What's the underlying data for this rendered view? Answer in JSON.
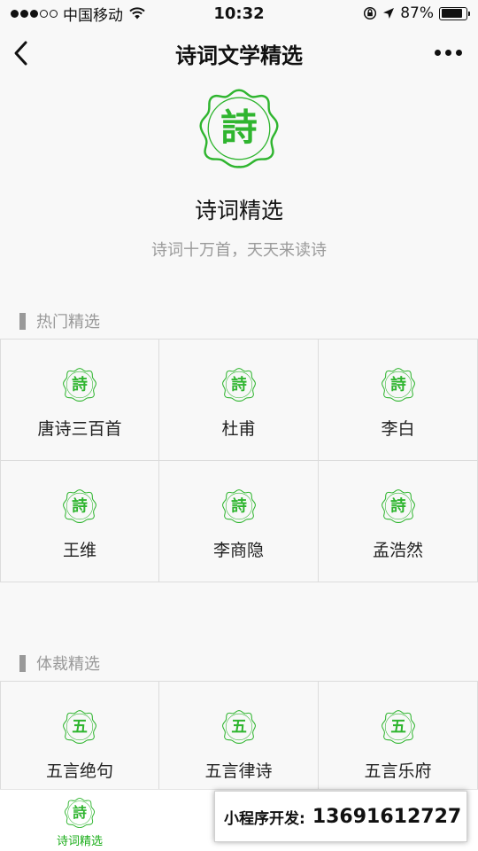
{
  "status_bar": {
    "carrier": "中国移动",
    "time": "10:32",
    "battery_percent": "87%",
    "battery_level": 0.87,
    "icons": [
      "wifi-icon",
      "rotation-lock-icon",
      "location-arrow-icon",
      "battery-icon"
    ]
  },
  "nav": {
    "title": "诗词文学精选",
    "icons": [
      "back-arrow-icon",
      "more-dots-icon"
    ]
  },
  "hero": {
    "logo_char": "詩",
    "title": "诗词精选",
    "subtitle": "诗词十万首，天天来读诗"
  },
  "sections": {
    "popular": {
      "title": "热门精选",
      "items": [
        {
          "icon_char": "詩",
          "label": "唐诗三百首"
        },
        {
          "icon_char": "詩",
          "label": "杜甫"
        },
        {
          "icon_char": "詩",
          "label": "李白"
        },
        {
          "icon_char": "詩",
          "label": "王维"
        },
        {
          "icon_char": "詩",
          "label": "李商隐"
        },
        {
          "icon_char": "詩",
          "label": "孟浩然"
        }
      ]
    },
    "genre": {
      "title": "体裁精选",
      "items": [
        {
          "icon_char": "五",
          "label": "五言绝句"
        },
        {
          "icon_char": "五",
          "label": "五言律诗"
        },
        {
          "icon_char": "五",
          "label": "五言乐府"
        }
      ]
    }
  },
  "tab_bar": {
    "items": [
      {
        "icon_char": "詩",
        "label": "诗词精选",
        "active": true
      }
    ]
  },
  "promo": {
    "label": "小程序开发:",
    "phone": "13691612727"
  },
  "colors": {
    "accent": "#1aad19",
    "icon_green": "#2fb52f",
    "muted_text": "#999999",
    "divider": "#dcdcdc"
  }
}
